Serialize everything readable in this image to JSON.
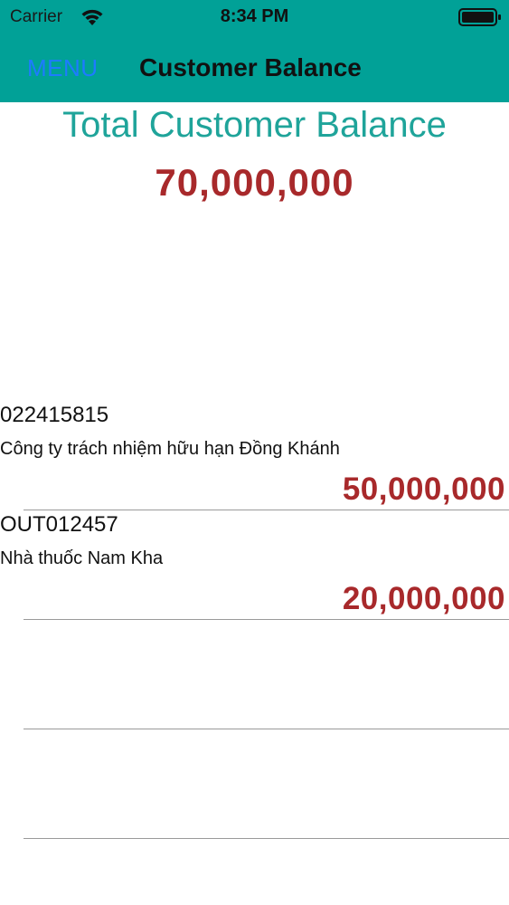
{
  "status_bar": {
    "carrier": "Carrier",
    "time": "8:34 PM"
  },
  "navbar": {
    "menu_label": "MENU",
    "title": "Customer Balance"
  },
  "summary": {
    "title": "Total Customer Balance",
    "amount": "70,000,000"
  },
  "customers": [
    {
      "code": "022415815",
      "name": "Công ty trách nhiệm hữu hạn Đồng Khánh",
      "balance": "50,000,000"
    },
    {
      "code": "OUT012457",
      "name": "Nhà thuốc Nam Kha",
      "balance": "20,000,000"
    },
    {
      "code": "",
      "name": "",
      "balance": ""
    },
    {
      "code": "",
      "name": "",
      "balance": ""
    }
  ],
  "colors": {
    "header_bg": "#01A197",
    "menu_link": "#1E7BFF",
    "summary_title": "#1FA49A",
    "amount": "#A8292B"
  },
  "icons": [
    "wifi-icon",
    "battery-icon"
  ]
}
